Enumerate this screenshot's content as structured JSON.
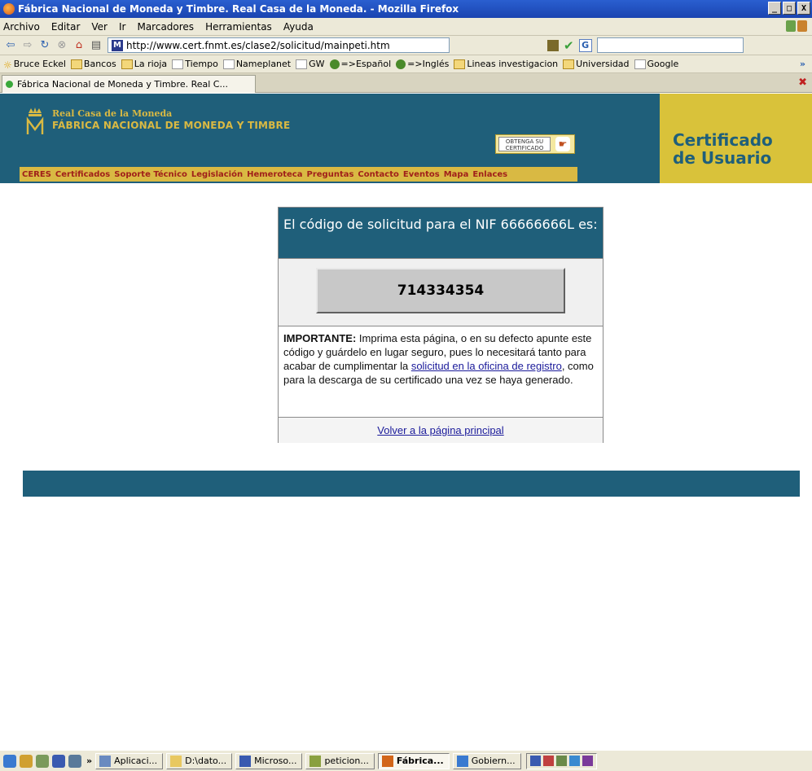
{
  "window": {
    "title": "Fábrica Nacional de Moneda y Timbre. Real Casa de la Moneda. - Mozilla Firefox",
    "minimize": "_",
    "maximize": "□",
    "close": "X"
  },
  "menu": [
    "Archivo",
    "Editar",
    "Ver",
    "Ir",
    "Marcadores",
    "Herramientas",
    "Ayuda"
  ],
  "nav": {
    "url": "http://www.cert.fnmt.es/clase2/solicitud/mainpeti.htm",
    "search_engine": "G"
  },
  "bookmarks": [
    {
      "label": "Bruce Eckel",
      "icon": "page"
    },
    {
      "label": "Bancos",
      "icon": "folder"
    },
    {
      "label": "La rioja",
      "icon": "folder"
    },
    {
      "label": "Tiempo",
      "icon": "page"
    },
    {
      "label": "Nameplanet",
      "icon": "page"
    },
    {
      "label": "GW",
      "icon": "page"
    },
    {
      "label": "=>Español",
      "icon": "flag"
    },
    {
      "label": "=>Inglés",
      "icon": "flag"
    },
    {
      "label": "Lineas investigacion",
      "icon": "folder"
    },
    {
      "label": "Universidad",
      "icon": "folder"
    },
    {
      "label": "Google",
      "icon": "page"
    }
  ],
  "tab": {
    "label": "Fábrica Nacional de Moneda y Timbre. Real C..."
  },
  "site": {
    "logo_line1": "Real Casa de la Moneda",
    "logo_line2": "FÁBRICA NACIONAL DE MONEDA Y TIMBRE",
    "obtain_label": "OBTENGA SU CERTIFICADO",
    "nav_items": [
      "CERES",
      "Certificados",
      "Soporte Técnico",
      "Legislación",
      "Hemeroteca",
      "Preguntas",
      "Contacto",
      "Eventos",
      "Mapa",
      "Enlaces"
    ],
    "panel_line1": "Certificado",
    "panel_line2": "de Usuario"
  },
  "box": {
    "heading": "El código de solicitud para el NIF 66666666L es:",
    "code": "714334354",
    "important_label": "IMPORTANTE:",
    "text_before_link": " Imprima esta página, o en su defecto apunte este código y guárdelo en lugar seguro, pues lo necesitará tanto para acabar de cumplimentar la ",
    "link_text": "solicitud en la oficina de registro",
    "text_after_link": ", como para la descarga de su certificado una vez se haya generado.",
    "back_link": "Volver a la página principal"
  },
  "taskbar": {
    "chevron": "»",
    "items": [
      {
        "label": "Aplicaci...",
        "active": false
      },
      {
        "label": "D:\\dato...",
        "active": false
      },
      {
        "label": "Microso...",
        "active": false
      },
      {
        "label": "peticion...",
        "active": false
      },
      {
        "label": "Fábrica...",
        "active": true
      },
      {
        "label": "Gobiern...",
        "active": false
      }
    ]
  },
  "colors": {
    "site_teal": "#1f5f7a",
    "site_gold": "#d9b943",
    "panel_yellow": "#d9c23a"
  }
}
